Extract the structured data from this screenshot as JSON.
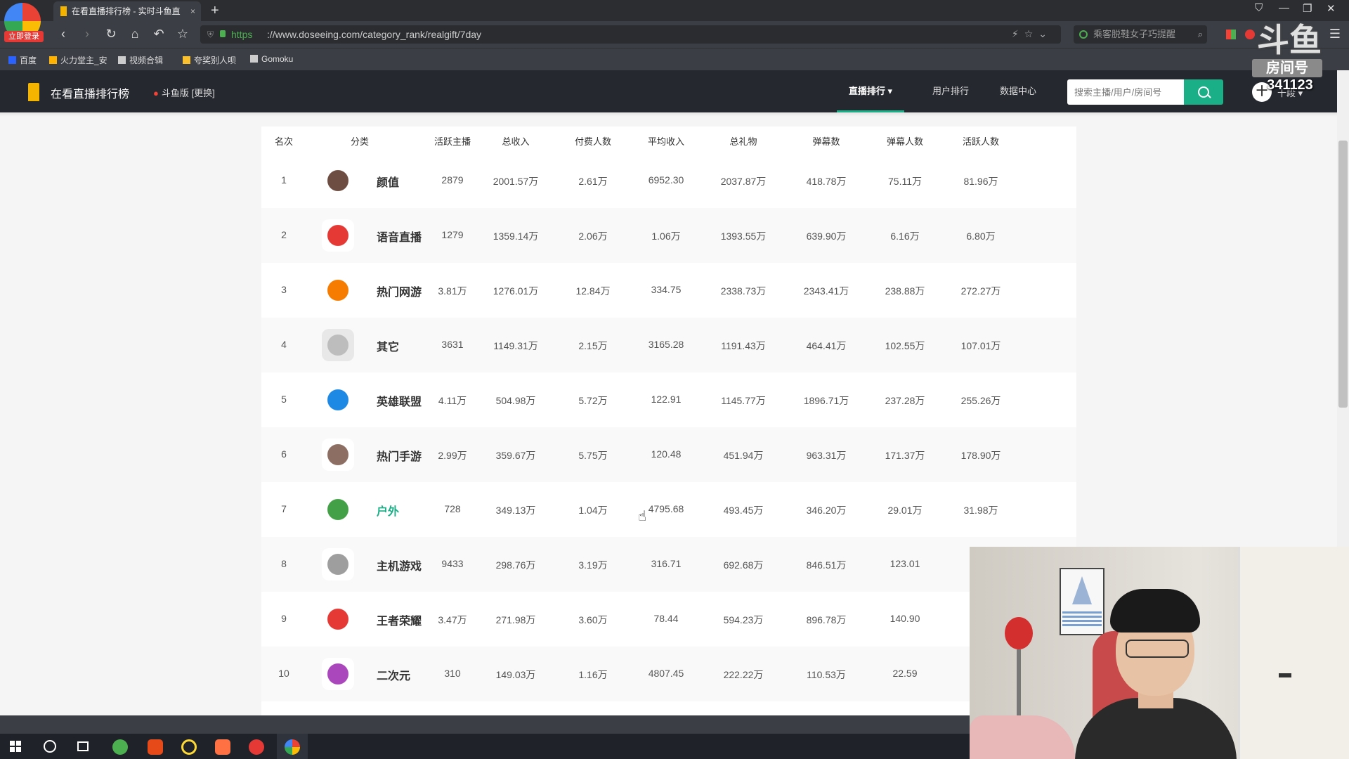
{
  "browser": {
    "tab_title": "在看直播排行榜 - 实时斗鱼直",
    "url_https": "https",
    "url_rest": "://www.doseeing.com/category_rank/realgift/7day",
    "search_placeholder": "乘客脱鞋女子巧提醒",
    "login_badge": "立即登录",
    "bookmarks": [
      "百度",
      "火力堂主_安",
      "视频合辑",
      "夸奖别人呗",
      "Gomoku"
    ]
  },
  "site": {
    "title": "在看直播排行榜",
    "switch_label": "斗鱼版 [更换]",
    "nav": [
      "直播排行 ▾",
      "用户排行",
      "数据中心"
    ],
    "search_placeholder": "搜索主播/用户/房间号",
    "user_name": "十段 ▾"
  },
  "watermark": {
    "room_label": "房间号",
    "room_number": "341123"
  },
  "table": {
    "headers": [
      "名次",
      "分类",
      "活跃主播",
      "总收入",
      "付费人数",
      "平均收入",
      "总礼物",
      "弹幕数",
      "弹幕人数",
      "活跃人数"
    ],
    "rows": [
      {
        "rank": "1",
        "name": "颜值",
        "active": "2879",
        "income": "2001.57万",
        "payers": "2.61万",
        "avg": "6952.30",
        "gifts": "2037.87万",
        "danmu": "418.78万",
        "danmu_users": "75.11万",
        "active_users": "81.96万",
        "icon": "face-icon",
        "color": "#6d4c41"
      },
      {
        "rank": "2",
        "name": "语音直播",
        "active": "1279",
        "income": "1359.14万",
        "payers": "2.06万",
        "avg": "1.06万",
        "gifts": "1393.55万",
        "danmu": "639.90万",
        "danmu_users": "6.16万",
        "active_users": "6.80万",
        "icon": "voice-icon",
        "color": "#e53935"
      },
      {
        "rank": "3",
        "name": "热门网游",
        "active": "3.81万",
        "income": "1276.01万",
        "payers": "12.84万",
        "avg": "334.75",
        "gifts": "2338.73万",
        "danmu": "2343.41万",
        "danmu_users": "238.88万",
        "active_users": "272.27万",
        "icon": "hot-game-icon",
        "color": "#f57c00"
      },
      {
        "rank": "4",
        "name": "其它",
        "active": "3631",
        "income": "1149.31万",
        "payers": "2.15万",
        "avg": "3165.28",
        "gifts": "1191.43万",
        "danmu": "464.41万",
        "danmu_users": "102.55万",
        "active_users": "107.01万",
        "icon": "shark-icon",
        "color": "#bdbdbd"
      },
      {
        "rank": "5",
        "name": "英雄联盟",
        "active": "4.11万",
        "income": "504.98万",
        "payers": "5.72万",
        "avg": "122.91",
        "gifts": "1145.77万",
        "danmu": "1896.71万",
        "danmu_users": "237.28万",
        "active_users": "255.26万",
        "icon": "lol-icon",
        "color": "#1e88e5"
      },
      {
        "rank": "6",
        "name": "热门手游",
        "active": "2.99万",
        "income": "359.67万",
        "payers": "5.75万",
        "avg": "120.48",
        "gifts": "451.94万",
        "danmu": "963.31万",
        "danmu_users": "171.37万",
        "active_users": "178.90万",
        "icon": "mobile-game-icon",
        "color": "#8d6e63"
      },
      {
        "rank": "7",
        "name": "户外",
        "active": "728",
        "income": "349.13万",
        "payers": "1.04万",
        "avg": "4795.68",
        "gifts": "493.45万",
        "danmu": "346.20万",
        "danmu_users": "29.01万",
        "active_users": "31.98万",
        "icon": "outdoor-icon",
        "color": "#43a047"
      },
      {
        "rank": "8",
        "name": "主机游戏",
        "active": "9433",
        "income": "298.76万",
        "payers": "3.19万",
        "avg": "316.71",
        "gifts": "692.68万",
        "danmu": "846.51万",
        "danmu_users": "123.01",
        "active_users": "",
        "icon": "gamepad-icon",
        "color": "#9e9e9e"
      },
      {
        "rank": "9",
        "name": "王者荣耀",
        "active": "3.47万",
        "income": "271.98万",
        "payers": "3.60万",
        "avg": "78.44",
        "gifts": "594.23万",
        "danmu": "896.78万",
        "danmu_users": "140.90",
        "active_users": "",
        "icon": "honor-of-kings-icon",
        "color": "#e53935"
      },
      {
        "rank": "10",
        "name": "二次元",
        "active": "310",
        "income": "149.03万",
        "payers": "1.16万",
        "avg": "4807.45",
        "gifts": "222.22万",
        "danmu": "110.53万",
        "danmu_users": "22.59",
        "active_users": "",
        "icon": "anime-icon",
        "color": "#ab47bc"
      }
    ]
  },
  "colors": {
    "accent": "#1aaf86",
    "header_bg": "#25282f",
    "brand_yellow": "#f5b400"
  }
}
